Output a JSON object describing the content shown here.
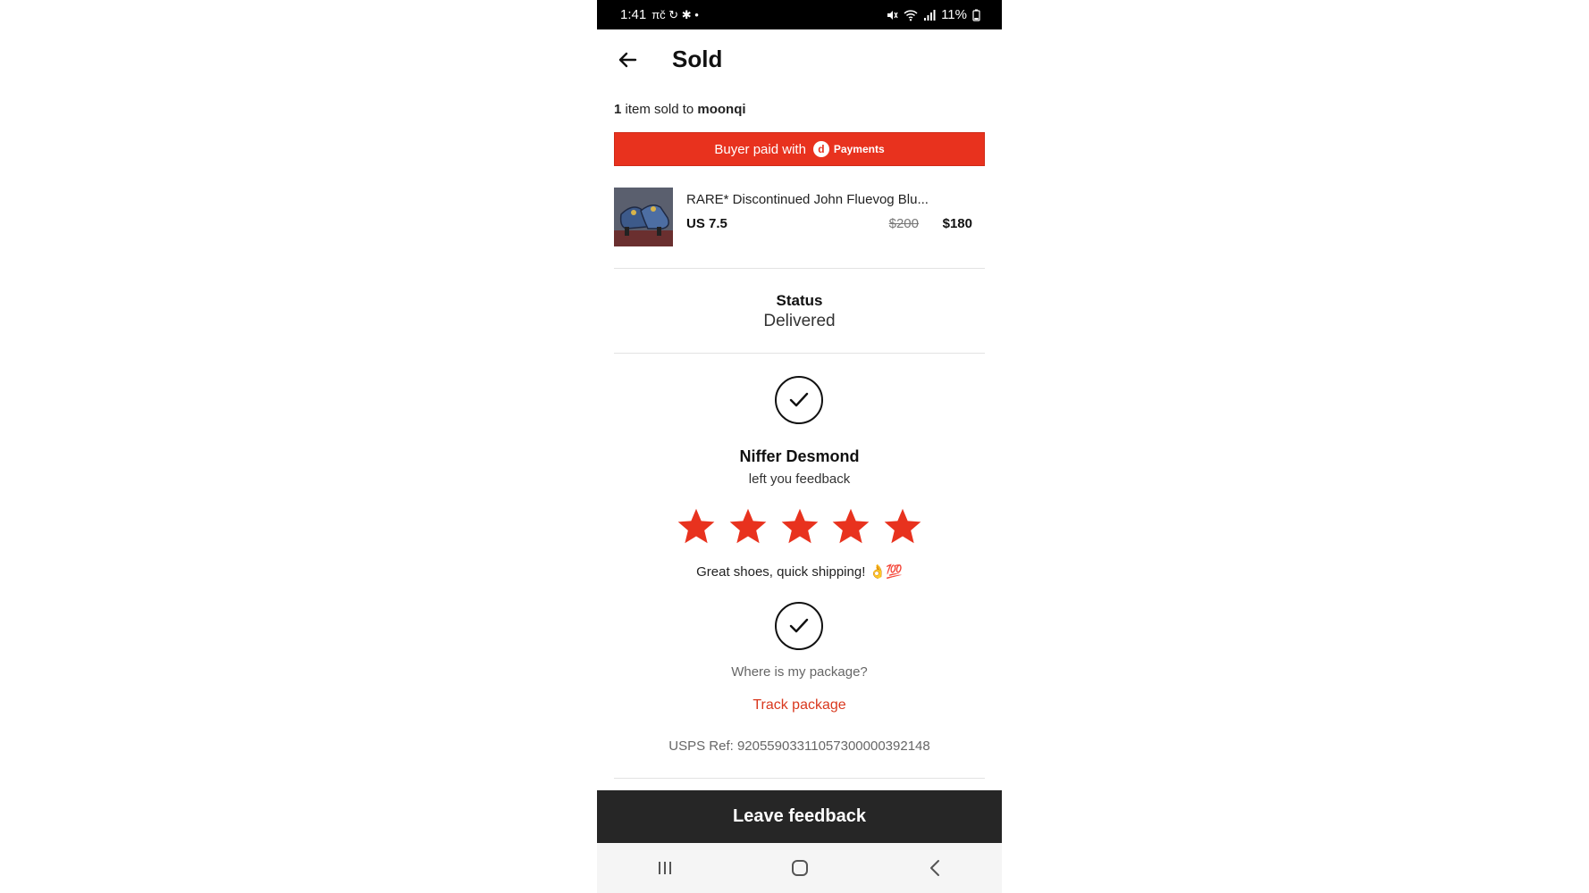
{
  "status_bar": {
    "time": "1:41",
    "left_icons": "πč ↻ ✱ •",
    "battery": "11%"
  },
  "header": {
    "title": "Sold"
  },
  "sold": {
    "count": "1",
    "middle": " item sold to ",
    "buyer": "moonqi"
  },
  "payment_banner": {
    "text": "Buyer paid with",
    "logo_letter": "d",
    "logo_text": "Payments"
  },
  "item": {
    "title": "RARE* Discontinued John Fluevog Blu...",
    "size": "US 7.5",
    "original_price": "$200",
    "price": "$180"
  },
  "status": {
    "label": "Status",
    "value": "Delivered"
  },
  "feedback": {
    "name": "Niffer Desmond",
    "subtitle": "left you feedback",
    "rating": 5,
    "max_rating": 5,
    "star_color": "#e8321e",
    "comment": "Great shoes, quick shipping! 👌💯"
  },
  "package": {
    "question": "Where is my package?",
    "track_label": "Track package",
    "usps_ref": "USPS Ref: 9205590331105730000039214​8"
  },
  "leave_feedback_label": "Leave feedback",
  "nav": {
    "recents": "recent-apps-icon",
    "home": "home-icon",
    "back": "back-icon"
  }
}
